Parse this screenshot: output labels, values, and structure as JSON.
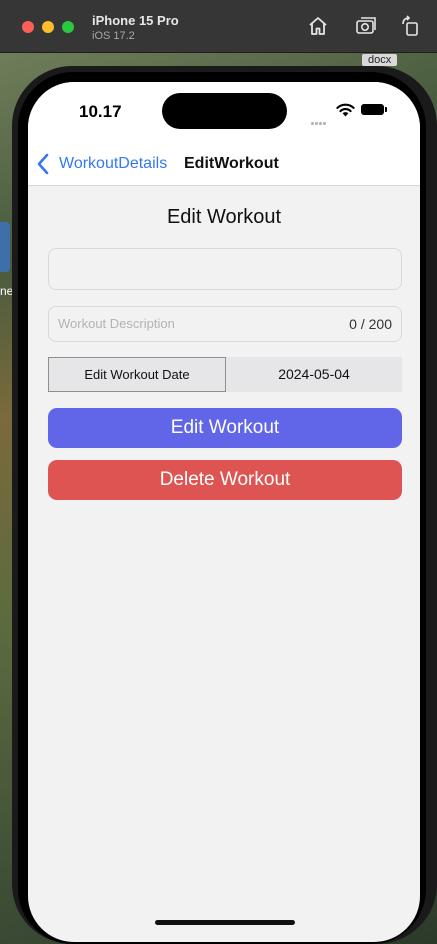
{
  "simulator": {
    "device_name": "iPhone 15 Pro",
    "os_version": "iOS 17.2",
    "toolbar_icons": [
      "home-icon",
      "screenshot-icon",
      "rotate-icon"
    ]
  },
  "desktop": {
    "file_label": "docx",
    "partial_label": "ne"
  },
  "status_bar": {
    "time": "10.17",
    "icons": [
      "signal-icon",
      "wifi-icon",
      "battery-icon"
    ]
  },
  "nav": {
    "back_label": "WorkoutDetails",
    "title": "EditWorkout"
  },
  "form": {
    "heading": "Edit Workout",
    "name_value": "",
    "description_placeholder": "Workout Description",
    "description_counter": "0 / 200",
    "date_button_label": "Edit Workout Date",
    "date_value": "2024-05-04",
    "edit_button_label": "Edit Workout",
    "delete_button_label": "Delete Workout"
  },
  "colors": {
    "accent_blue": "#3478f6",
    "edit_button": "#6166e8",
    "delete_button": "#dd5452"
  }
}
